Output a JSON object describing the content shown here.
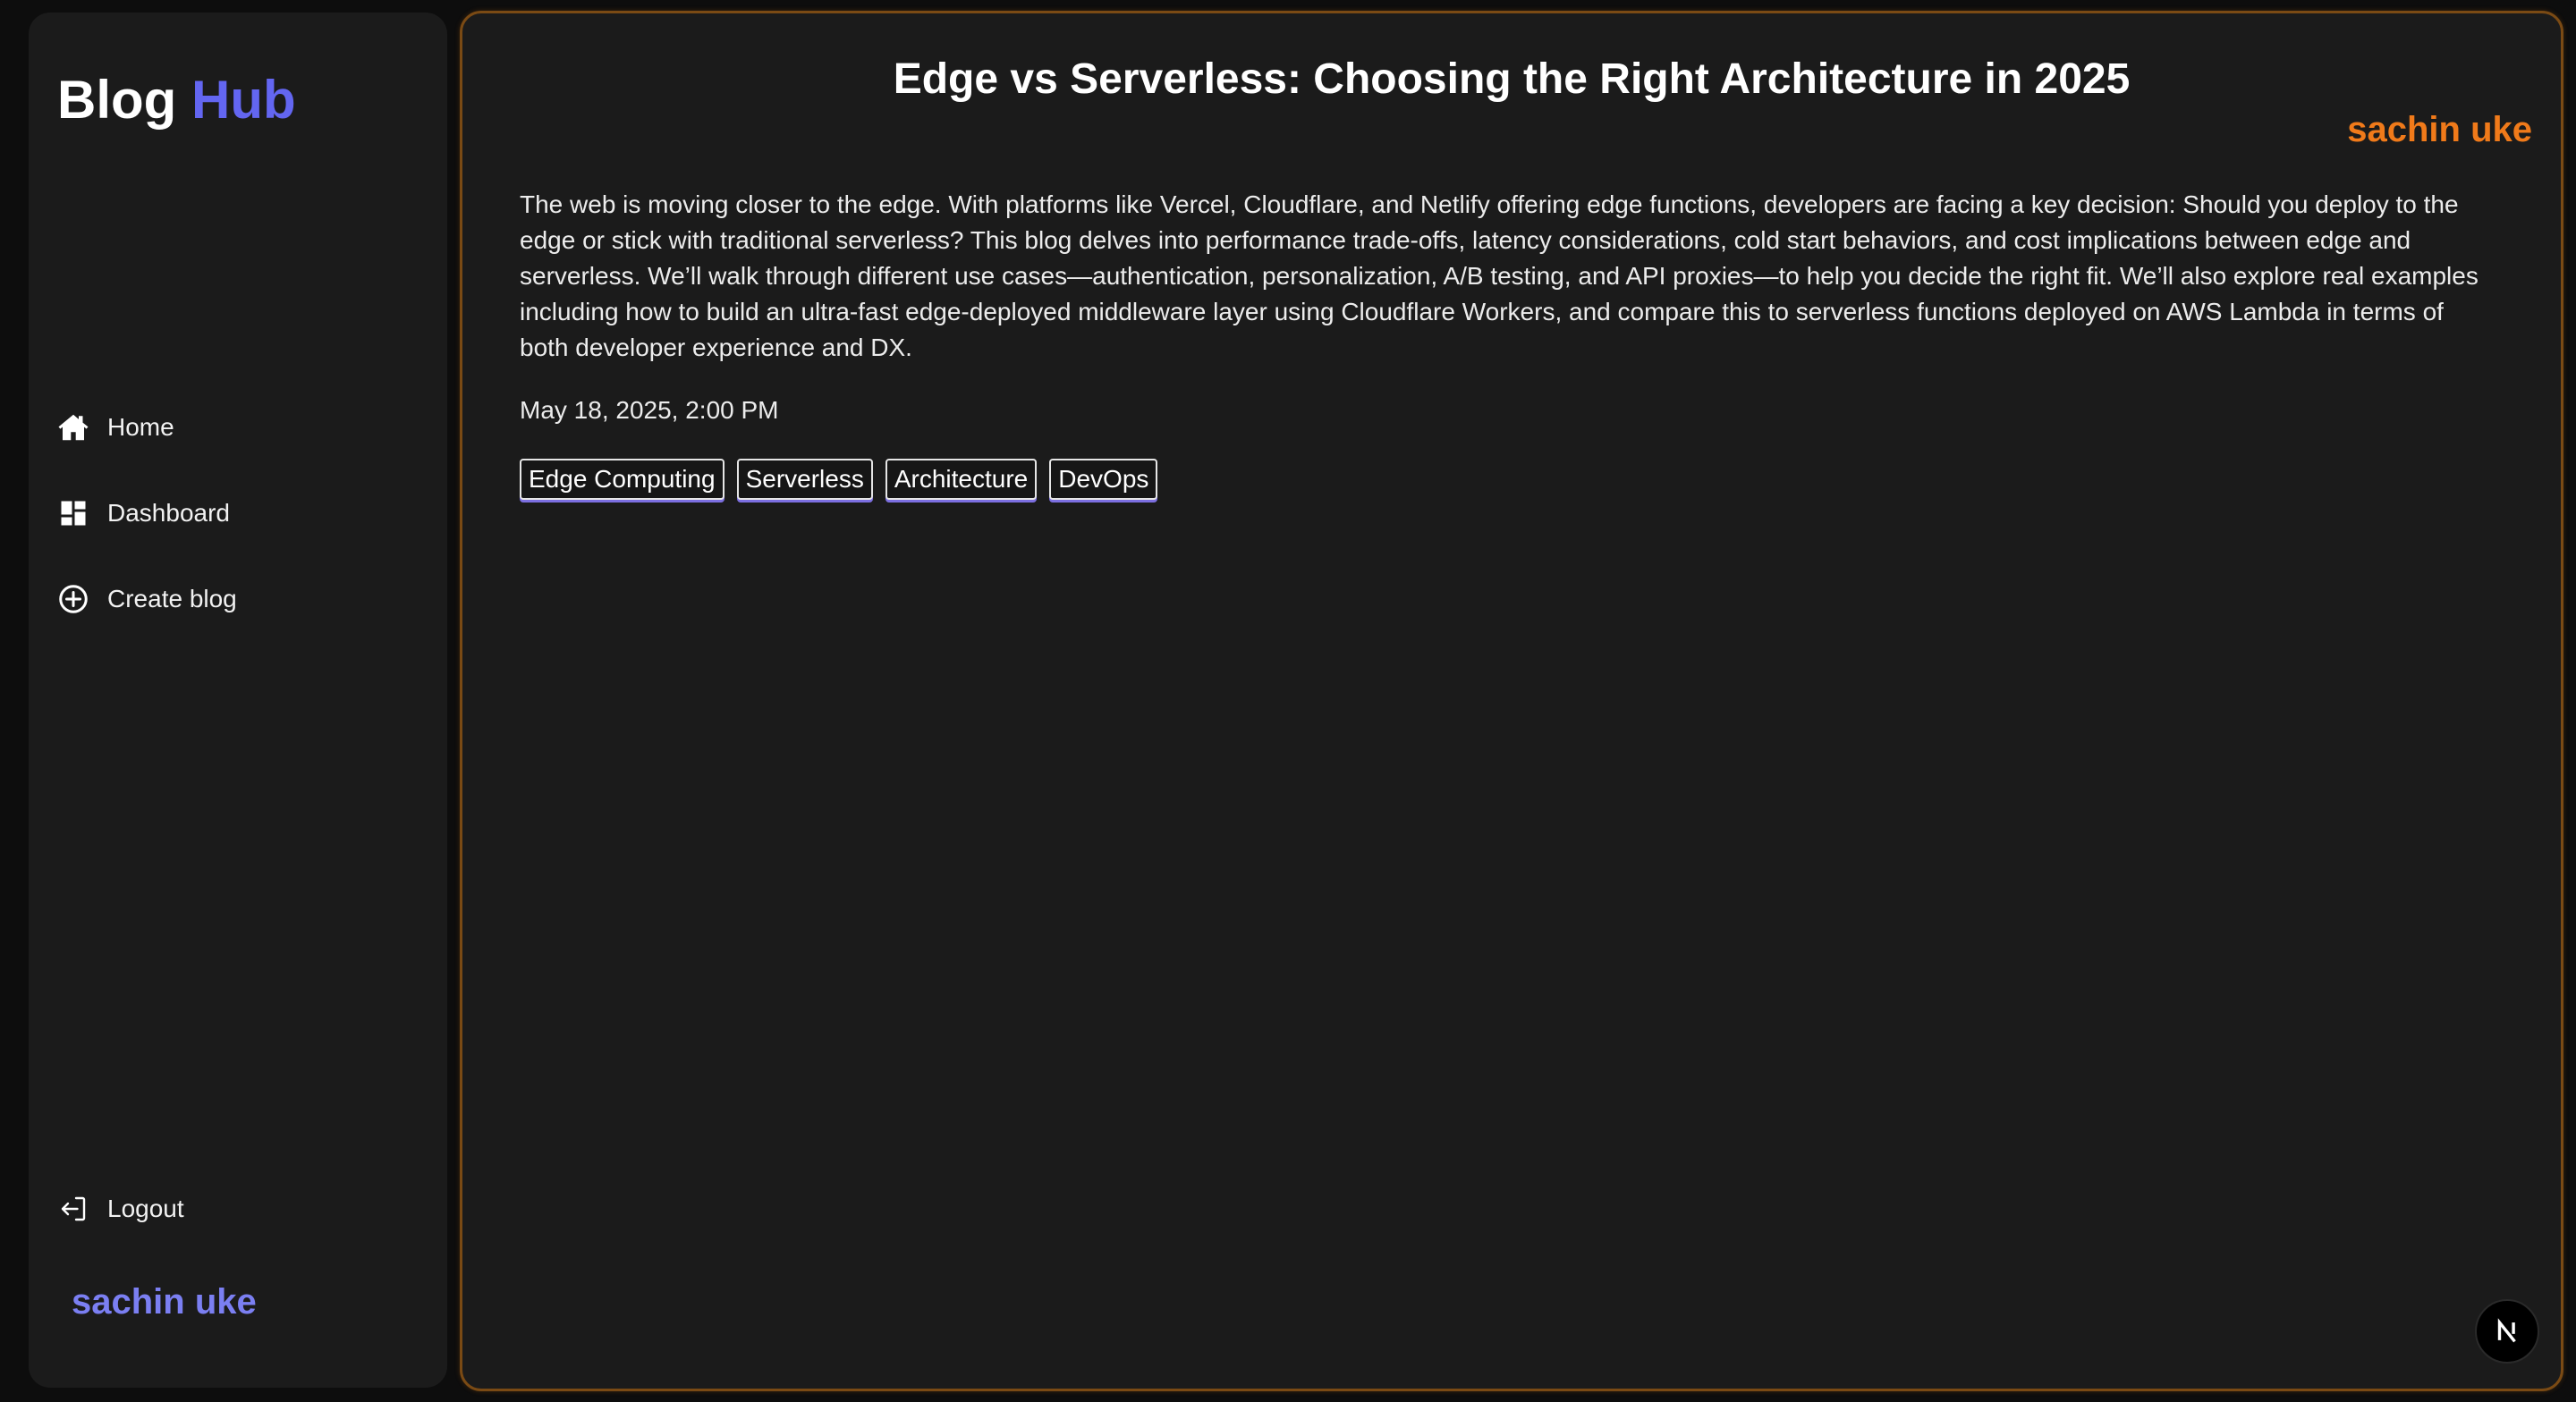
{
  "brand": {
    "part1": "Blog",
    "part2": "Hub"
  },
  "sidebar": {
    "items": [
      {
        "label": "Home",
        "icon": "home-icon"
      },
      {
        "label": "Dashboard",
        "icon": "dashboard-icon"
      },
      {
        "label": "Create blog",
        "icon": "plus-circle-icon"
      }
    ],
    "logout_label": "Logout",
    "user_name": "sachin uke"
  },
  "post": {
    "title": "Edge vs Serverless: Choosing the Right Architecture in 2025",
    "author": "sachin uke",
    "body": "The web is moving closer to the edge. With platforms like Vercel, Cloudflare, and Netlify offering edge functions, developers are facing a key decision: Should you deploy to the edge or stick with traditional serverless? This blog delves into performance trade-offs, latency considerations, cold start behaviors, and cost implications between edge and serverless. We’ll walk through different use cases—authentication, personalization, A/B testing, and API proxies—to help you decide the right fit. We’ll also explore real examples including how to build an ultra-fast edge-deployed middleware layer using Cloudflare Workers, and compare this to serverless functions deployed on AWS Lambda in terms of both developer experience and DX.",
    "date": "May 18, 2025, 2:00 PM",
    "tags": [
      "Edge Computing",
      "Serverless",
      "Architecture",
      "DevOps"
    ]
  },
  "fab": {
    "icon": "nextjs-logo-icon"
  },
  "colors": {
    "accent": "#6366f1",
    "author": "#f07a1a",
    "sidebar_user": "#7b7ff2",
    "panel_border": "#7a4a14",
    "background": "#0d0d0d",
    "panel": "#1b1b1b"
  }
}
